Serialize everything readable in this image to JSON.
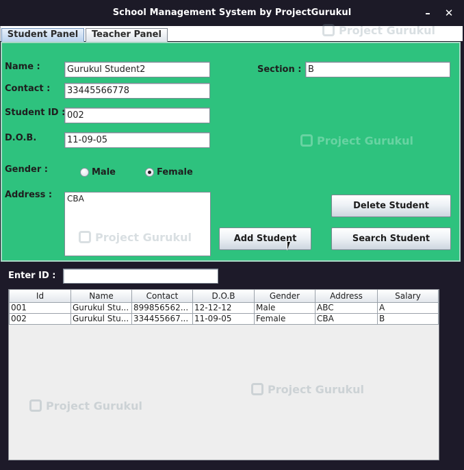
{
  "window": {
    "title": "School Management System by ProjectGurukul",
    "minimize_glyph": "–",
    "close_glyph": "✕"
  },
  "tabs": [
    {
      "label": "Student Panel",
      "selected": true
    },
    {
      "label": "Teacher Panel",
      "selected": false
    }
  ],
  "form": {
    "name_label": "Name :",
    "name_value": "Gurukul Student2",
    "contact_label": "Contact :",
    "contact_value": "33445566778",
    "student_id_label": "Student ID :",
    "student_id_value": "002",
    "dob_label": "D.O.B.",
    "dob_value": "11-09-05",
    "section_label": "Section  :",
    "section_value": "B",
    "gender_label": "Gender :",
    "gender_options": [
      {
        "label": "Male",
        "selected": false
      },
      {
        "label": "Female",
        "selected": true
      }
    ],
    "address_label": "Address :",
    "address_value": "CBA"
  },
  "buttons": {
    "delete": "Delete Student",
    "add": "Add Student",
    "search": "Search Student"
  },
  "search": {
    "enter_id_label": "Enter ID  :",
    "value": ""
  },
  "table": {
    "columns": [
      "Id",
      "Name",
      "Contact",
      "D.O.B",
      "Gender",
      "Address",
      "Salary"
    ],
    "rows": [
      [
        "001",
        "Gurukul Stu...",
        "899856562...",
        "12-12-12",
        "Male",
        "ABC",
        "A"
      ],
      [
        "002",
        "Gurukul Stu...",
        "334455667...",
        "11-09-05",
        "Female",
        "CBA",
        "B"
      ]
    ]
  },
  "watermark": {
    "text": "Project Gurukul"
  },
  "colors": {
    "panel_bg": "#2ec27e",
    "window_bg": "#1d1a29",
    "titlebar_bg": "#1c1a27"
  }
}
